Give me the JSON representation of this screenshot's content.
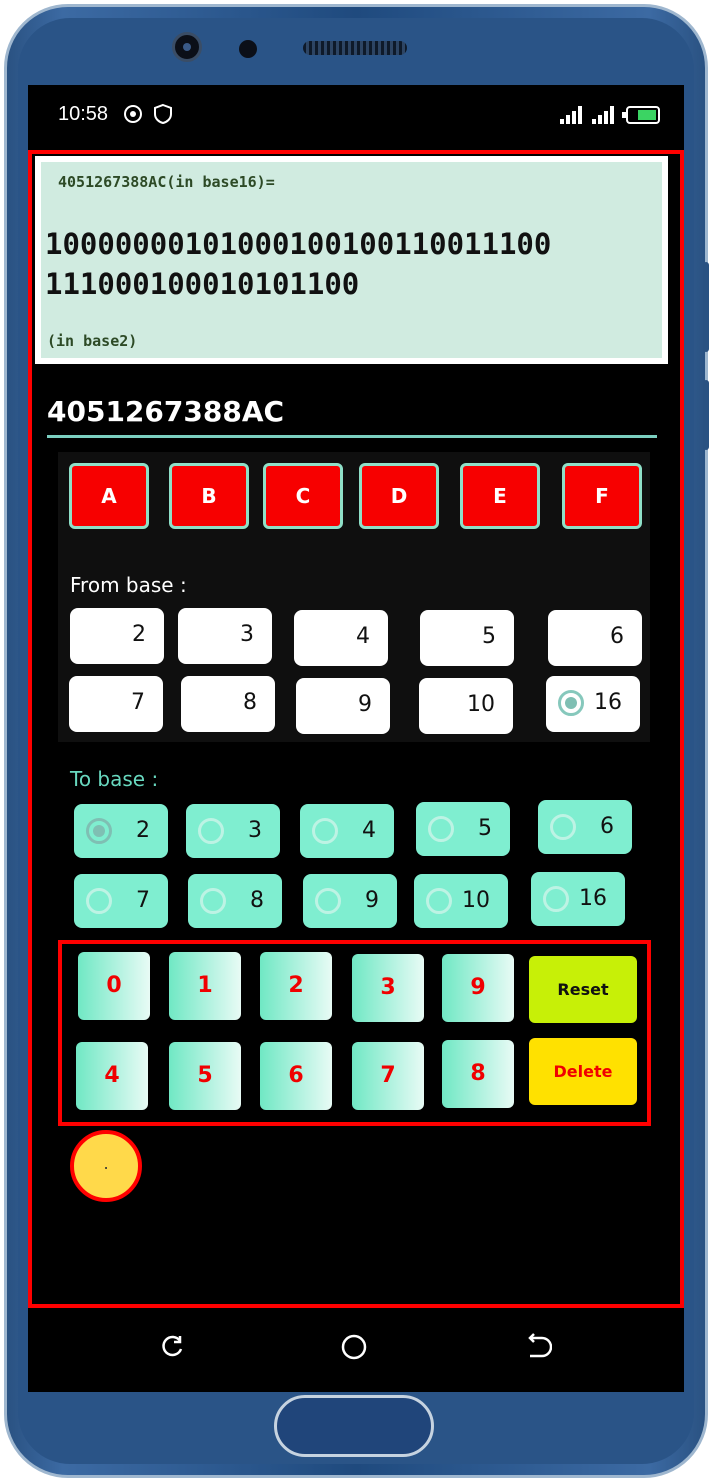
{
  "status_bar": {
    "time": "10:58",
    "icons": [
      "settings-circle-icon",
      "shield-icon",
      "signal-icon",
      "signal-icon",
      "battery-charging-icon"
    ]
  },
  "result": {
    "input_label": "4051267388AC(in base16)=",
    "value": "100000001010001001001100111001110001000101011 00",
    "base_label": "(in base2)"
  },
  "input": {
    "value": "4051267388AC"
  },
  "hex_keys": [
    "A",
    "B",
    "C",
    "D",
    "E",
    "F"
  ],
  "from_base": {
    "label": "From base :",
    "options": [
      "2",
      "3",
      "4",
      "5",
      "6",
      "7",
      "8",
      "9",
      "10",
      "16"
    ],
    "selected": "16"
  },
  "to_base": {
    "label": "To base :",
    "options": [
      "2",
      "3",
      "4",
      "5",
      "6",
      "7",
      "8",
      "9",
      "10",
      "16"
    ],
    "selected": "2"
  },
  "keypad": {
    "row1": [
      "0",
      "1",
      "2",
      "3",
      "9"
    ],
    "row2": [
      "4",
      "5",
      "6",
      "7",
      "8"
    ],
    "reset": "Reset",
    "delete": "Delete",
    "dot": "."
  },
  "colors": {
    "accent_red": "#ff0000",
    "mint": "#7feed0",
    "result_bg": "#d0ebe0",
    "reset_bg": "#c7f007",
    "delete_bg": "#ffe100"
  },
  "nav_bar": {
    "icons": [
      "recent-apps-icon",
      "home-icon",
      "back-icon"
    ]
  }
}
